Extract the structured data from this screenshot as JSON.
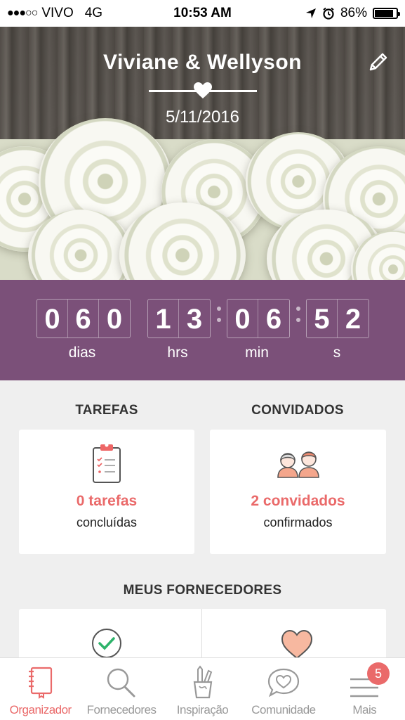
{
  "status_bar": {
    "signal": "●●●○○",
    "carrier": "VIVO",
    "network": "4G",
    "time": "10:53 AM",
    "battery": "86%",
    "battery_level": 0.86
  },
  "header": {
    "couple": "Viviane & Wellyson",
    "date": "5/11/2016",
    "edit_icon": "pencil-icon"
  },
  "countdown": {
    "days": [
      "0",
      "6",
      "0"
    ],
    "hours": [
      "1",
      "3"
    ],
    "minutes": [
      "0",
      "6"
    ],
    "seconds": [
      "5",
      "2"
    ],
    "labels": {
      "days": "dias",
      "hours": "hrs",
      "minutes": "min",
      "seconds": "s"
    }
  },
  "tasks": {
    "title": "TAREFAS",
    "count": "0 tarefas",
    "sub": "concluídas",
    "icon": "clipboard-icon"
  },
  "guests": {
    "title": "CONVIDADOS",
    "count": "2 convidados",
    "sub": "confirmados",
    "icon": "couple-icon"
  },
  "suppliers": {
    "title": "MEUS FORNECEDORES",
    "icons": [
      "checkmark-circle-icon",
      "heart-icon"
    ]
  },
  "tabs": [
    {
      "label": "Organizador",
      "icon": "notebook-icon",
      "active": true
    },
    {
      "label": "Fornecedores",
      "icon": "search-icon",
      "active": false
    },
    {
      "label": "Inspiração",
      "icon": "pencil-cup-icon",
      "active": false
    },
    {
      "label": "Comunidade",
      "icon": "chat-heart-icon",
      "active": false
    },
    {
      "label": "Mais",
      "icon": "menu-icon",
      "active": false,
      "badge": "5"
    }
  ],
  "colors": {
    "accent": "#ea6a6a",
    "countdown_bg": "#7b5079",
    "background": "#efefef"
  }
}
